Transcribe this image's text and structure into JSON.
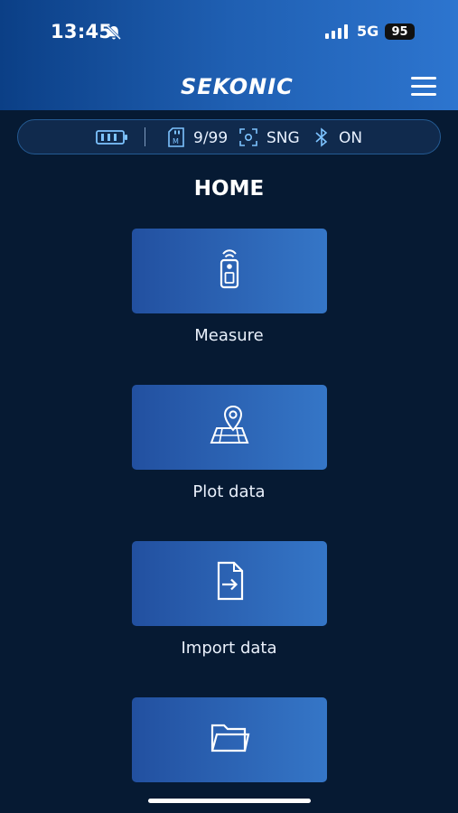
{
  "status_bar": {
    "time": "13:45",
    "network": "5G",
    "battery": "95"
  },
  "header": {
    "logo": "SEKONIC"
  },
  "info_bar": {
    "memory": "9/99",
    "mode": "SNG",
    "bluetooth": "ON"
  },
  "page": {
    "title": "HOME"
  },
  "menu_items": [
    {
      "label": "Measure",
      "icon": "meter-icon"
    },
    {
      "label": "Plot data",
      "icon": "map-pin-icon"
    },
    {
      "label": "Import data",
      "icon": "file-import-icon"
    },
    {
      "label": "",
      "icon": "folder-icon"
    }
  ],
  "colors": {
    "background": "#061a33",
    "header_start": "#0b3f86",
    "header_end": "#2d75cf",
    "tile_start": "#2250a0",
    "tile_end": "#3576c7"
  }
}
